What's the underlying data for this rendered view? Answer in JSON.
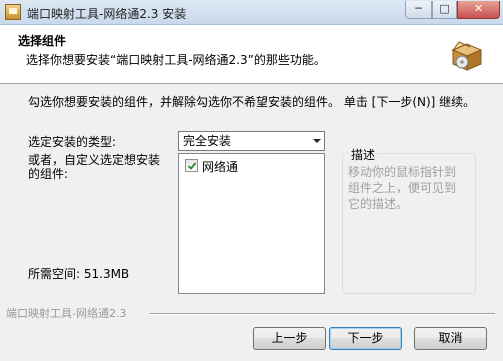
{
  "window": {
    "title": "端口映射工具-网络通2.3 安装",
    "controls": {
      "minimize": "─",
      "maximize": "□",
      "close": "✕"
    }
  },
  "header": {
    "title": "选择组件",
    "subtitle": "选择你想要安装“端口映射工具-网络通2.3”的那些功能。",
    "icon": "installer-box-icon"
  },
  "instructions": "勾选你想要安装的组件，并解除勾选你不希望安装的组件。 单击 [下一步(N)] 继续。",
  "install_type": {
    "label": "选定安装的类型:",
    "selected": "完全安装"
  },
  "custom_label": "或者，自定义选定想安装的组件:",
  "components": [
    {
      "name": "网络通",
      "checked": true
    }
  ],
  "description": {
    "legend": "描述",
    "text": "移动你的鼠标指针到组件之上，便可见到它的描述。"
  },
  "space_required": "所需空间: 51.3MB",
  "footer": {
    "brand": "端口映射工具-网络通2.3"
  },
  "buttons": {
    "back": "上一步",
    "next": "下一步",
    "cancel": "取消"
  },
  "colors": {
    "accent_border": "#3c7fb1",
    "checkmark": "#2a8a2a"
  }
}
